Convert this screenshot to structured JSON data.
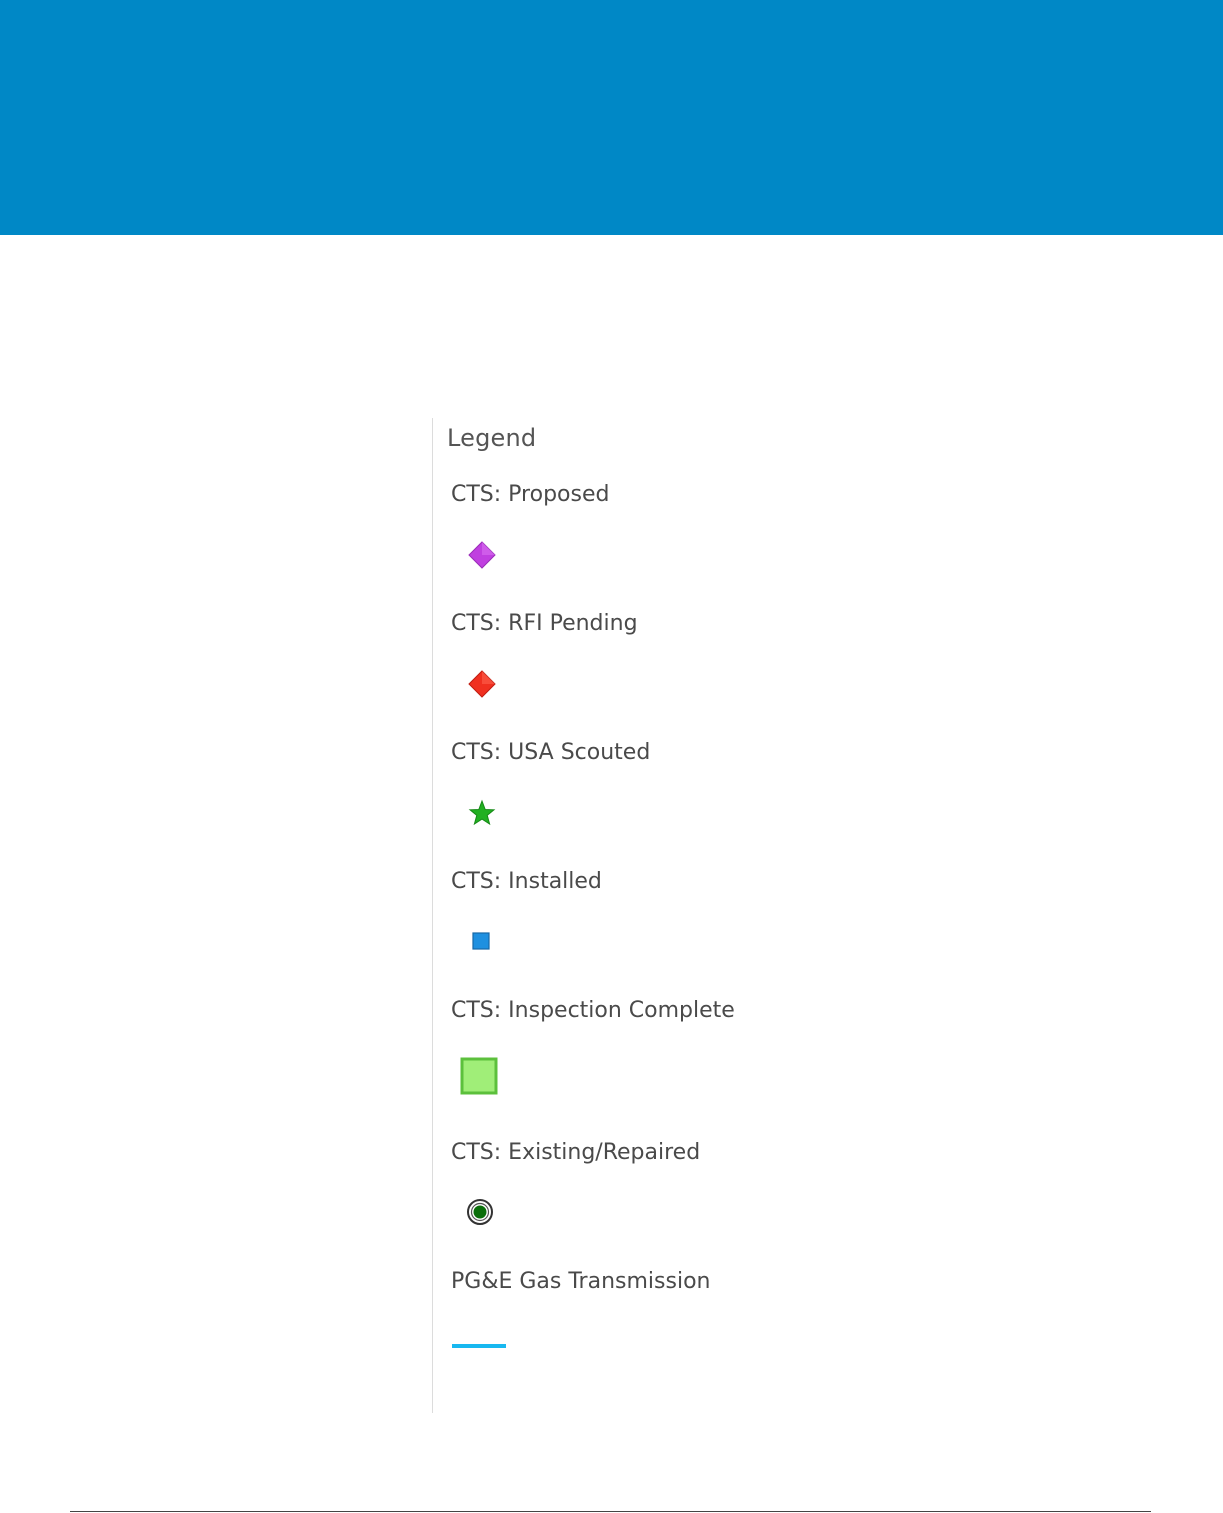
{
  "header": {
    "banner_color": "#0088c6"
  },
  "legend": {
    "title": "Legend",
    "layers": [
      {
        "label": "CTS: Proposed",
        "symbol": "purple-diamond-icon",
        "color": "#c040e0"
      },
      {
        "label": "CTS: RFI Pending",
        "symbol": "red-diamond-icon",
        "color": "#f03020"
      },
      {
        "label": "CTS: USA Scouted",
        "symbol": "green-star-icon",
        "color": "#22b022"
      },
      {
        "label": "CTS: Installed",
        "symbol": "blue-square-icon",
        "color": "#1e90e0"
      },
      {
        "label": "CTS: Inspection Complete",
        "symbol": "light-green-square-icon",
        "color": "#a0ee78"
      },
      {
        "label": "CTS: Existing/Repaired",
        "symbol": "dark-green-bullseye-icon",
        "color": "#0a6e0a"
      },
      {
        "label": "PG&E Gas Transmission",
        "symbol": "cyan-line-icon",
        "color": "#18b8f0"
      }
    ]
  }
}
